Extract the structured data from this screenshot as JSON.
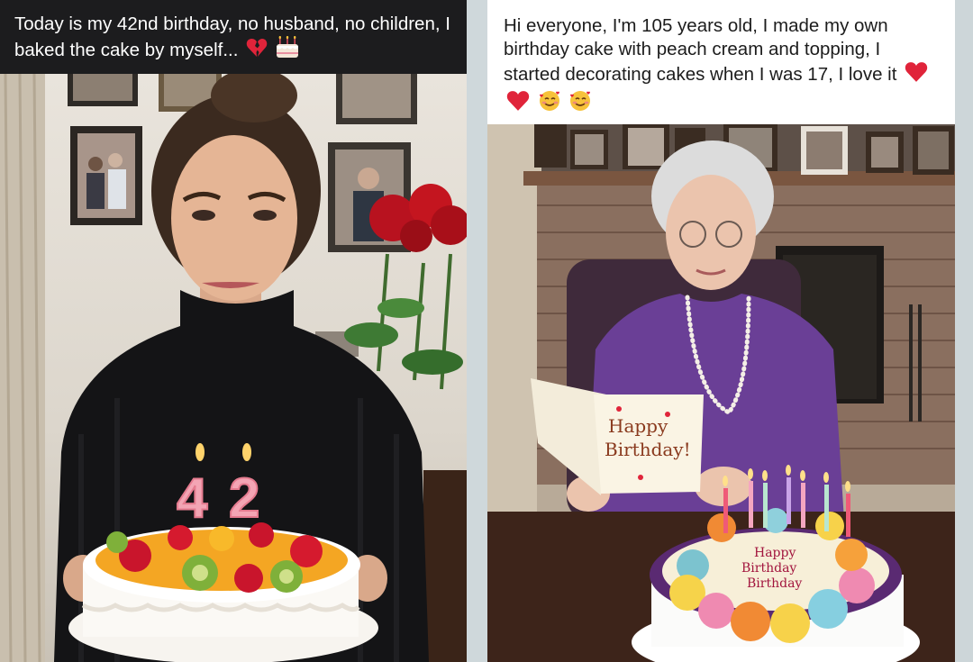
{
  "posts": [
    {
      "caption": "Today is my 42nd birthday, no husband, no children, I baked the cake by myself...",
      "emojis": [
        "broken-heart-icon",
        "birthday-cake-icon"
      ],
      "photo": {
        "candle_number": "42"
      }
    },
    {
      "caption": "Hi everyone, I'm 105 years old, I made my own birthday cake with peach cream and topping, I started decorating cakes when I was 17, I love it",
      "emojis": [
        "red-heart-icon",
        "red-heart-icon",
        "smiling-face-with-hearts-icon",
        "smiling-face-with-hearts-icon"
      ],
      "photo": {
        "card_line1": "Happy",
        "card_line2": "Birthday!",
        "cake_line1": "Happy",
        "cake_line2": "Birthday",
        "cake_line3": "Birthday"
      }
    }
  ],
  "colors": {
    "dark_caption_bg": "#1c1c1e",
    "light_caption_bg": "#ffffff",
    "divider": "#cfd8db",
    "heart_red": "#e0243a"
  }
}
